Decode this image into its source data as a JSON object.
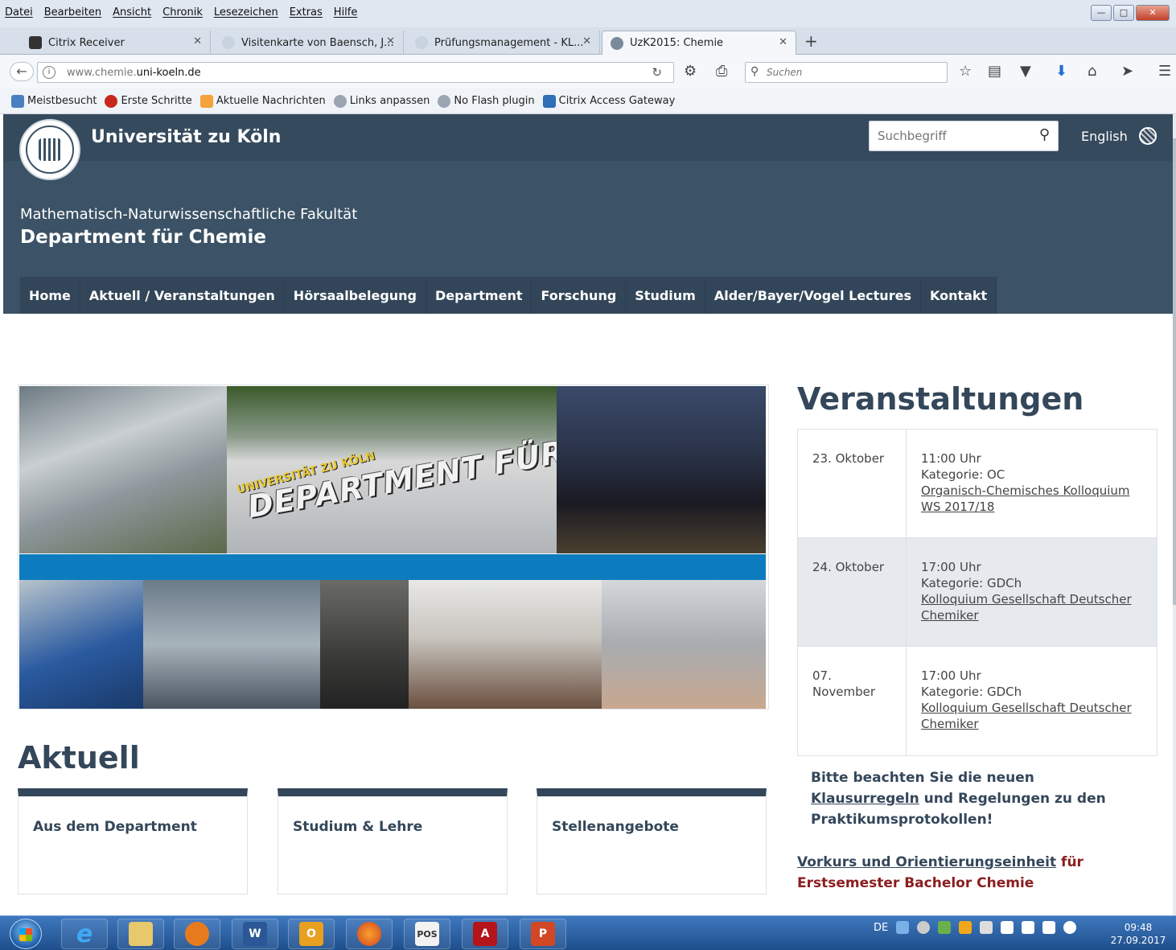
{
  "menubar": {
    "items": [
      "Datei",
      "Bearbeiten",
      "Ansicht",
      "Chronik",
      "Lesezeichen",
      "Extras",
      "Hilfe"
    ]
  },
  "tabs": [
    {
      "label": "Citrix Receiver",
      "active": false
    },
    {
      "label": "Visitenkarte von Baensch, J...",
      "active": false
    },
    {
      "label": "Prüfungsmanagement - KL...",
      "active": false
    },
    {
      "label": "UzK2015: Chemie",
      "active": true
    }
  ],
  "navbar": {
    "url_dim": "www.chemie.",
    "url_main": "uni-koeln.de",
    "search_placeholder": "Suchen"
  },
  "bookmarks": [
    "Meistbesucht",
    "Erste Schritte",
    "Aktuelle Nachrichten",
    "Links anpassen",
    "No Flash plugin",
    "Citrix Access Gateway"
  ],
  "header": {
    "university": "Universität zu Köln",
    "search_placeholder": "Suchbegriff",
    "language": "English",
    "faculty": "Mathematisch-Naturwissenschaftliche Fakultät",
    "department": "Department für Chemie"
  },
  "mainnav": [
    "Home",
    "Aktuell / Veranstaltungen",
    "Hörsaalbelegung",
    "Department",
    "Forschung",
    "Studium",
    "Alder/Bayer/Vogel Lectures",
    "Kontakt"
  ],
  "banner": {
    "graffiti_small": "UNIVERSITÄT ZU KÖLN",
    "graffiti_main": "DEPARTMENT FÜR CHEMIE"
  },
  "aktuell": {
    "title": "Aktuell",
    "cards": [
      "Aus dem Department",
      "Studium & Lehre",
      "Stellenangebote"
    ]
  },
  "veranstaltungen": {
    "title": "Veranstaltungen",
    "events": [
      {
        "date": "23. Oktober",
        "time": "11:00 Uhr",
        "category": "Kategorie: OC",
        "link": "Organisch-Chemisches Kolloquium WS 2017/18"
      },
      {
        "date": "24. Oktober",
        "time": "17:00 Uhr",
        "category": "Kategorie: GDCh",
        "link": "Kolloquium Gesellschaft Deutscher Chemiker"
      },
      {
        "date": "07. November",
        "time": "17:00 Uhr",
        "category": "Kategorie: GDCh",
        "link": "Kolloquium Gesellschaft Deutscher Chemiker"
      }
    ]
  },
  "notice": {
    "pre": "Bitte beachten Sie die neuen ",
    "link": "Klausurregeln",
    "post": " und Regelungen zu den Praktikumsprotokollen!"
  },
  "vorkurs": {
    "link": "Vorkurs und Orientierungseinheit",
    "post": " für Erstsemester Bachelor Chemie"
  },
  "taskbar": {
    "lang": "DE",
    "time": "09:48",
    "date": "27.09.2017"
  }
}
